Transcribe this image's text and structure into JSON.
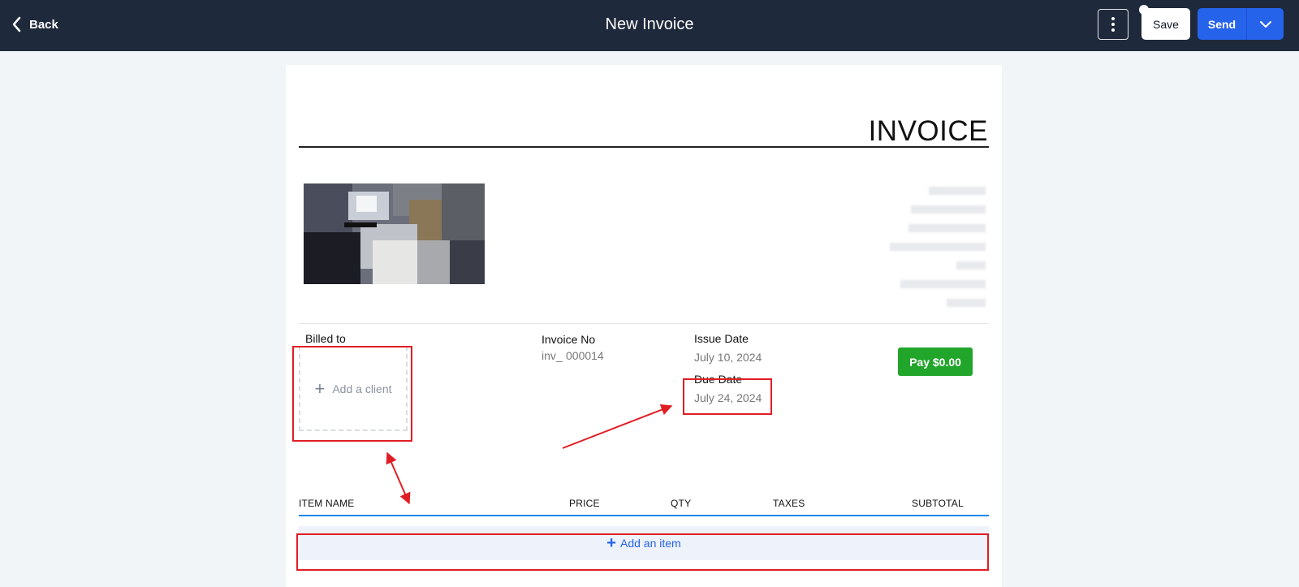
{
  "topbar": {
    "back_label": "Back",
    "title": "New Invoice",
    "save_label": "Save",
    "send_label": "Send",
    "colors": {
      "background": "#1e293b",
      "send": "#2563eb"
    }
  },
  "invoice": {
    "heading": "INVOICE",
    "billed_to_label": "Billed to",
    "add_client_label": "Add a client",
    "invoice_no_label": "Invoice No",
    "invoice_no_prefix": "inv_",
    "invoice_no_value": "000014",
    "issue_date_label": "Issue Date",
    "issue_date_value": "July 10, 2024",
    "due_date_label": "Due Date",
    "due_date_value": "July 24, 2024",
    "pay_button_label": "Pay $0.00",
    "pay_color": "#22a52b"
  },
  "items": {
    "columns": [
      "ITEM NAME",
      "PRICE",
      "QTY",
      "TAXES",
      "SUBTOTAL"
    ],
    "add_item_label": "Add an item"
  },
  "annotations": {
    "highlight_color": "#e11d24"
  }
}
